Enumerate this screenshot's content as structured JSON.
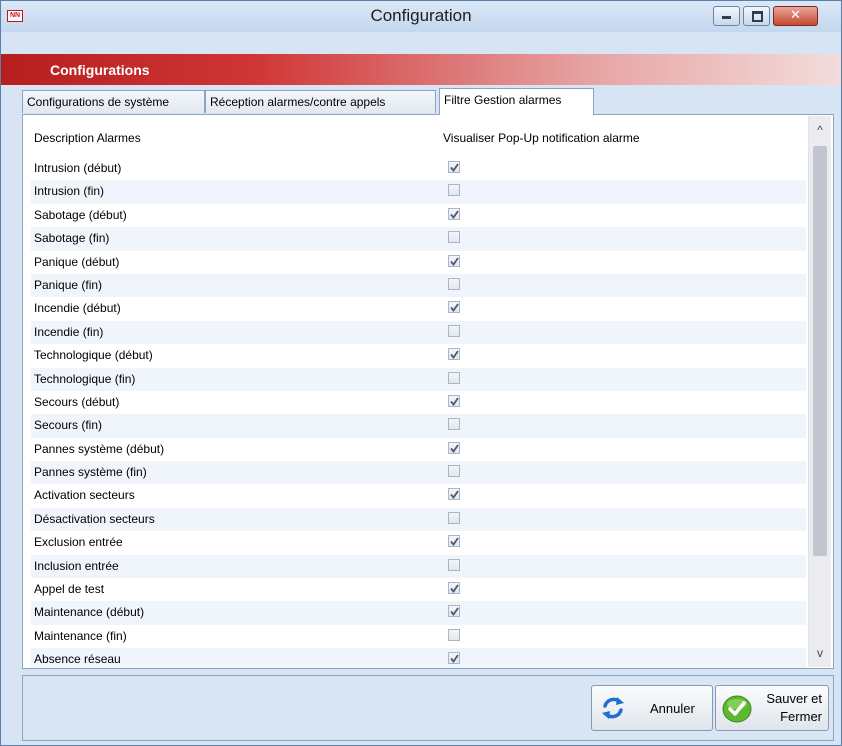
{
  "window": {
    "title": "Configuration",
    "app_icon_text": "NN",
    "close_glyph": "✕"
  },
  "banner": {
    "title": "Configurations"
  },
  "tabs": [
    {
      "label": "Configurations de système",
      "active": false
    },
    {
      "label": "Réception alarmes/contre appels",
      "active": false
    },
    {
      "label": "Filtre Gestion alarmes",
      "active": true
    }
  ],
  "grid": {
    "headers": {
      "description": "Description Alarmes",
      "visualiser": "Visualiser Pop-Up notification alarme"
    },
    "rows": [
      {
        "label": "Intrusion (début)",
        "checked": true
      },
      {
        "label": "Intrusion (fin)",
        "checked": false
      },
      {
        "label": "Sabotage (début)",
        "checked": true
      },
      {
        "label": "Sabotage (fin)",
        "checked": false
      },
      {
        "label": "Panique (début)",
        "checked": true
      },
      {
        "label": "Panique (fin)",
        "checked": false
      },
      {
        "label": "Incendie (début)",
        "checked": true
      },
      {
        "label": "Incendie (fin)",
        "checked": false
      },
      {
        "label": "Technologique (début)",
        "checked": true
      },
      {
        "label": "Technologique (fin)",
        "checked": false
      },
      {
        "label": "Secours (début)",
        "checked": true
      },
      {
        "label": "Secours (fin)",
        "checked": false
      },
      {
        "label": "Pannes système (début)",
        "checked": true
      },
      {
        "label": "Pannes système (fin)",
        "checked": false
      },
      {
        "label": "Activation secteurs",
        "checked": true
      },
      {
        "label": "Désactivation secteurs",
        "checked": false
      },
      {
        "label": "Exclusion entrée",
        "checked": true
      },
      {
        "label": "Inclusion entrée",
        "checked": false
      },
      {
        "label": "Appel de test",
        "checked": true
      },
      {
        "label": "Maintenance (début)",
        "checked": true
      },
      {
        "label": "Maintenance (fin)",
        "checked": false
      },
      {
        "label": "Absence réseau",
        "checked": true
      }
    ]
  },
  "scrollbar": {
    "up_glyph": "^",
    "down_glyph": "v"
  },
  "footer": {
    "annuler_label": "Annuler",
    "sauver_label": "Sauver et\nFermer"
  },
  "colors": {
    "banner_red": "#b71f1f",
    "window_frame": "#d6e4f3",
    "row_alt": "#f0f5fb",
    "checkmark": "#4b5a70",
    "save_icon_green": "#5cb82e",
    "refresh_icon_blue": "#1f6fd1"
  }
}
